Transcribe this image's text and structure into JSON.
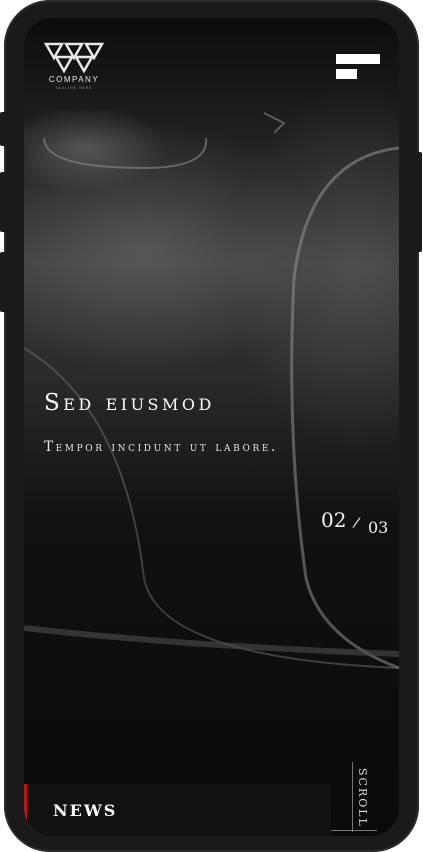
{
  "brand": {
    "name": "COMPANY",
    "tagline": "TAGLINE HERE"
  },
  "menu": {
    "icon": "hamburger-menu-icon"
  },
  "hero": {
    "title": "Sed eiusmod",
    "subtitle": "Tempor incidunt ut labore.",
    "slide": {
      "current": "02",
      "separator": "/",
      "total": "03"
    }
  },
  "news": {
    "label": "NEWS",
    "accent_color": "#c2121d"
  },
  "scroll": {
    "label": "SCROLL"
  }
}
